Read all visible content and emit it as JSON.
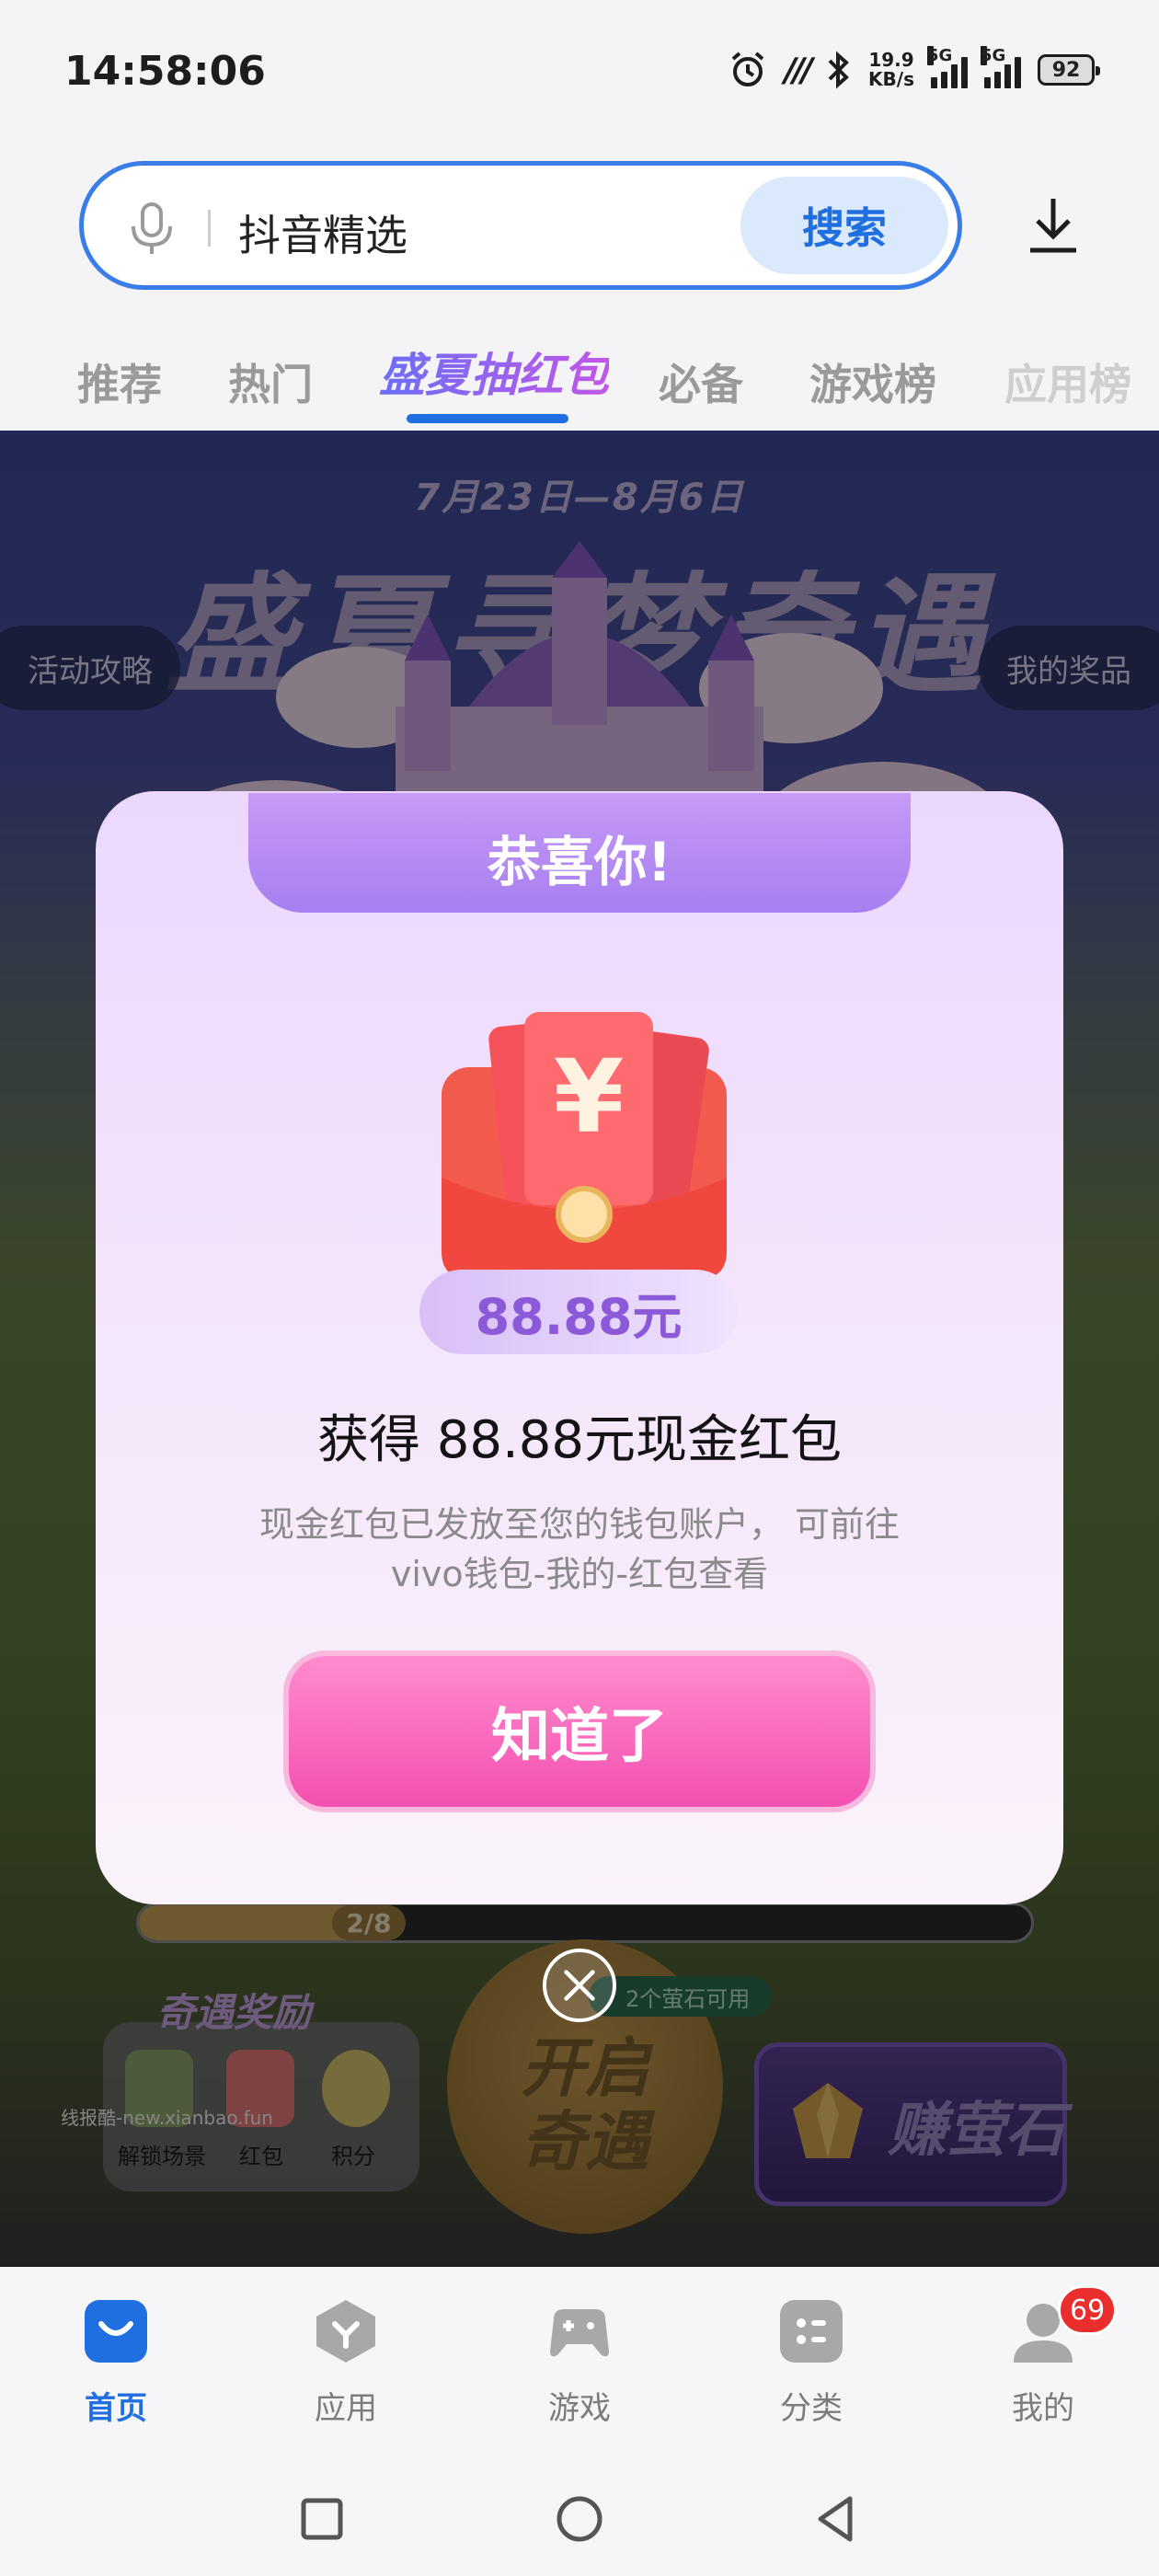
{
  "status_bar": {
    "time": "14:58:06",
    "alarm_icon": "alarm-icon",
    "nfc_label": "m",
    "speed_value": "19.9",
    "speed_unit": "KB/s",
    "network1": "5G",
    "network2": "5G",
    "battery": "92"
  },
  "search": {
    "query": "抖音精选",
    "button_label": "搜索"
  },
  "tabs": [
    {
      "label": "推荐"
    },
    {
      "label": "热门"
    },
    {
      "label": "盛夏抽红包"
    },
    {
      "label": "必备"
    },
    {
      "label": "游戏榜"
    },
    {
      "label": "应用榜"
    }
  ],
  "banner": {
    "date_range": "7月23日—8月6日",
    "title": "盛夏寻梦奇遇",
    "left_pill": "活动攻略",
    "right_pill": "我的奖品"
  },
  "progress": {
    "label": "2/8",
    "fraction": 0.25
  },
  "rewards": {
    "title": "奇遇奖励",
    "items": [
      {
        "label": "解锁场景"
      },
      {
        "label": "红包"
      },
      {
        "label": "积分"
      }
    ]
  },
  "start_button": {
    "line1": "开启",
    "line2": "奇遇"
  },
  "gem_badge": "2个萤石可用",
  "earn_button": "赚萤石",
  "watermark": "线报酷-new.xianbao.fun",
  "modal": {
    "header": "恭喜你!",
    "amount": "88.88元",
    "title": "获得 88.88元现金红包",
    "desc_line1": "现金红包已发放至您的钱包账户， 可前往",
    "desc_line2": "vivo钱包-我的-红包查看",
    "button": "知道了"
  },
  "bottom_nav": [
    {
      "label": "首页",
      "icon": "home-bag-icon",
      "active": true
    },
    {
      "label": "应用",
      "icon": "apps-icon",
      "active": false
    },
    {
      "label": "游戏",
      "icon": "gamepad-icon",
      "active": false
    },
    {
      "label": "分类",
      "icon": "category-icon",
      "active": false
    },
    {
      "label": "我的",
      "icon": "profile-icon",
      "active": false,
      "badge": "69"
    }
  ],
  "colors": {
    "accent": "#1f6fe0",
    "modal_button": "#f44fb0",
    "badge": "#ea2d2d"
  }
}
